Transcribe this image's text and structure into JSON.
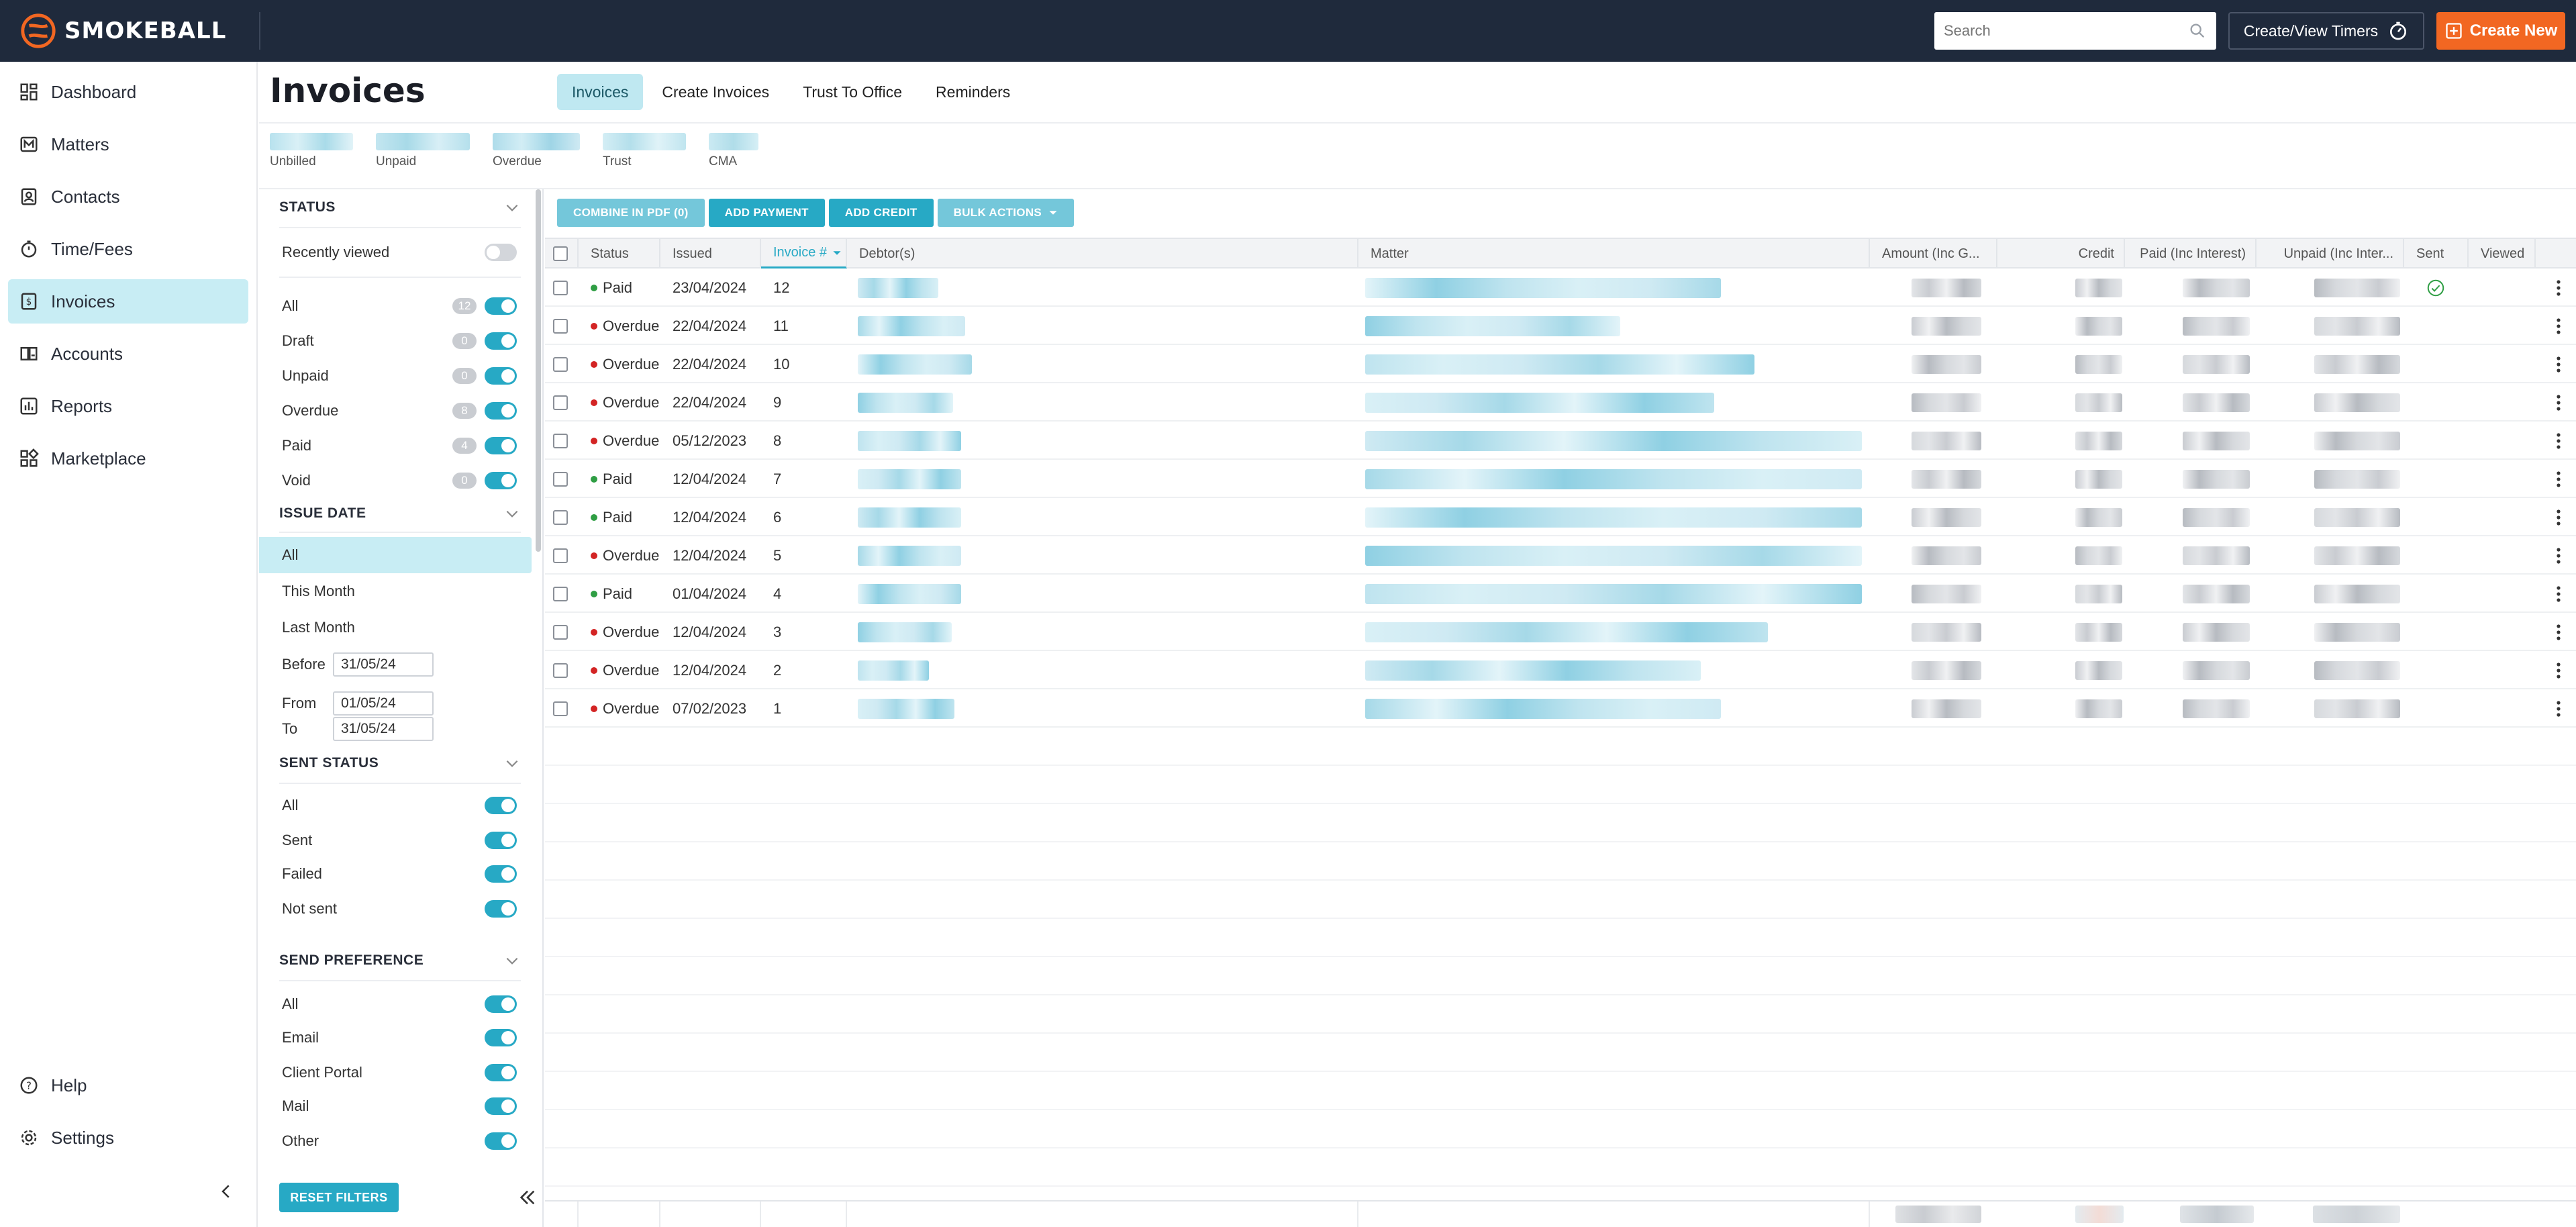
{
  "app": {
    "brand": "SMOKEBALL"
  },
  "topbar": {
    "search_placeholder": "Search",
    "timers_label": "Create/View Timers",
    "create_label": "Create New"
  },
  "nav": {
    "items": [
      {
        "label": "Dashboard",
        "icon": "dashboard-icon"
      },
      {
        "label": "Matters",
        "icon": "matters-icon"
      },
      {
        "label": "Contacts",
        "icon": "contacts-icon"
      },
      {
        "label": "Time/Fees",
        "icon": "stopwatch-icon"
      },
      {
        "label": "Invoices",
        "icon": "invoice-icon",
        "active": true
      },
      {
        "label": "Accounts",
        "icon": "accounts-icon"
      },
      {
        "label": "Reports",
        "icon": "reports-icon"
      },
      {
        "label": "Marketplace",
        "icon": "marketplace-icon"
      }
    ],
    "bottom": [
      {
        "label": "Help",
        "icon": "help-icon"
      },
      {
        "label": "Settings",
        "icon": "gear-icon"
      }
    ]
  },
  "page": {
    "title": "Invoices",
    "tabs": [
      "Invoices",
      "Create Invoices",
      "Trust To Office",
      "Reminders"
    ],
    "summary_labels": [
      "Unbilled",
      "Unpaid",
      "Overdue",
      "Trust",
      "CMA"
    ]
  },
  "filters": {
    "status": {
      "title": "STATUS",
      "recently_viewed": "Recently viewed",
      "items": [
        {
          "label": "All",
          "count": "12"
        },
        {
          "label": "Draft",
          "count": "0"
        },
        {
          "label": "Unpaid",
          "count": "0"
        },
        {
          "label": "Overdue",
          "count": "8"
        },
        {
          "label": "Paid",
          "count": "4"
        },
        {
          "label": "Void",
          "count": "0"
        }
      ]
    },
    "issue_date": {
      "title": "ISSUE DATE",
      "options": [
        "All",
        "This Month",
        "Last Month"
      ],
      "before_label": "Before",
      "before_value": "31/05/24",
      "from_label": "From",
      "from_value": "01/05/24",
      "to_label": "To",
      "to_value": "31/05/24"
    },
    "sent_status": {
      "title": "SENT STATUS",
      "items": [
        "All",
        "Sent",
        "Failed",
        "Not sent"
      ]
    },
    "send_preference": {
      "title": "SEND PREFERENCE",
      "items": [
        "All",
        "Email",
        "Client Portal",
        "Mail",
        "Other"
      ]
    },
    "reset_label": "RESET FILTERS"
  },
  "actions": {
    "combine": "COMBINE IN PDF (0)",
    "add_payment": "ADD PAYMENT",
    "add_credit": "ADD CREDIT",
    "bulk": "BULK ACTIONS"
  },
  "table": {
    "columns": [
      "Status",
      "Issued",
      "Invoice #",
      "Debtor(s)",
      "Matter",
      "Amount (Inc G...",
      "Credit",
      "Paid (Inc Interest)",
      "Unpaid (Inc Inter...",
      "Sent",
      "Viewed"
    ],
    "rows": [
      {
        "status": "Paid",
        "issued": "23/04/2024",
        "invoice": "12",
        "sent": true
      },
      {
        "status": "Overdue",
        "issued": "22/04/2024",
        "invoice": "11"
      },
      {
        "status": "Overdue",
        "issued": "22/04/2024",
        "invoice": "10"
      },
      {
        "status": "Overdue",
        "issued": "22/04/2024",
        "invoice": "9"
      },
      {
        "status": "Overdue",
        "issued": "05/12/2023",
        "invoice": "8"
      },
      {
        "status": "Paid",
        "issued": "12/04/2024",
        "invoice": "7"
      },
      {
        "status": "Paid",
        "issued": "12/04/2024",
        "invoice": "6"
      },
      {
        "status": "Overdue",
        "issued": "12/04/2024",
        "invoice": "5"
      },
      {
        "status": "Paid",
        "issued": "01/04/2024",
        "invoice": "4"
      },
      {
        "status": "Overdue",
        "issued": "12/04/2024",
        "invoice": "3"
      },
      {
        "status": "Overdue",
        "issued": "12/04/2024",
        "invoice": "2"
      },
      {
        "status": "Overdue",
        "issued": "07/02/2023",
        "invoice": "1"
      }
    ]
  },
  "colors": {
    "accent": "#27a9c5",
    "brand_orange": "#f26722",
    "topbar": "#1f2a3c",
    "paid": "#2f9e44",
    "overdue": "#d32424"
  }
}
